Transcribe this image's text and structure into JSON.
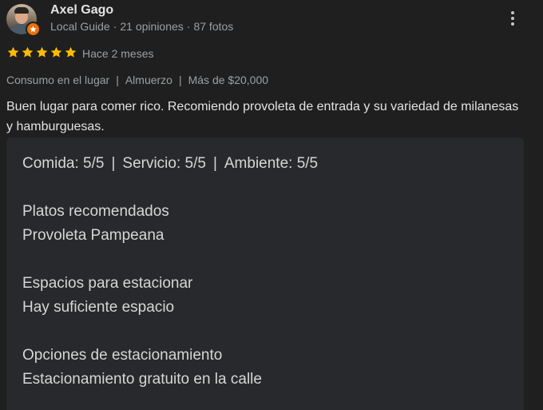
{
  "author": {
    "name": "Axel Gago",
    "level": "Local Guide",
    "reviews": "21 opiniones",
    "photos": "87 fotos",
    "separator": "·"
  },
  "rating": {
    "stars": 5,
    "max": 5,
    "star_color": "#fbbc04",
    "time_ago": "Hace 2 meses"
  },
  "tags": {
    "service": "Consumo en el lugar",
    "meal": "Almuerzo",
    "price": "Más de $20,000",
    "separator": "|"
  },
  "review_text": "Buen lugar para comer rico. Recomiendo provoleta de entrada y su variedad de milanesas y hamburguesas.",
  "details": {
    "scores": {
      "food": "Comida: 5/5",
      "service": "Servicio: 5/5",
      "ambience": "Ambiente: 5/5",
      "separator": "|"
    },
    "recommended_heading": "Platos recomendados",
    "recommended_value": "Provoleta Pampeana",
    "parking_space_heading": "Espacios para estacionar",
    "parking_space_value": "Hay suficiente espacio",
    "parking_options_heading": "Opciones de estacionamiento",
    "parking_options_value": "Estacionamiento gratuito en la calle"
  },
  "icons": {
    "more": "more-vert-icon",
    "star": "star-icon",
    "badge": "local-guide-badge-icon"
  },
  "colors": {
    "background": "#1f1f1f",
    "detail_background": "#28292c",
    "badge": "#e8710a",
    "secondary_text": "#9aa0a6"
  }
}
